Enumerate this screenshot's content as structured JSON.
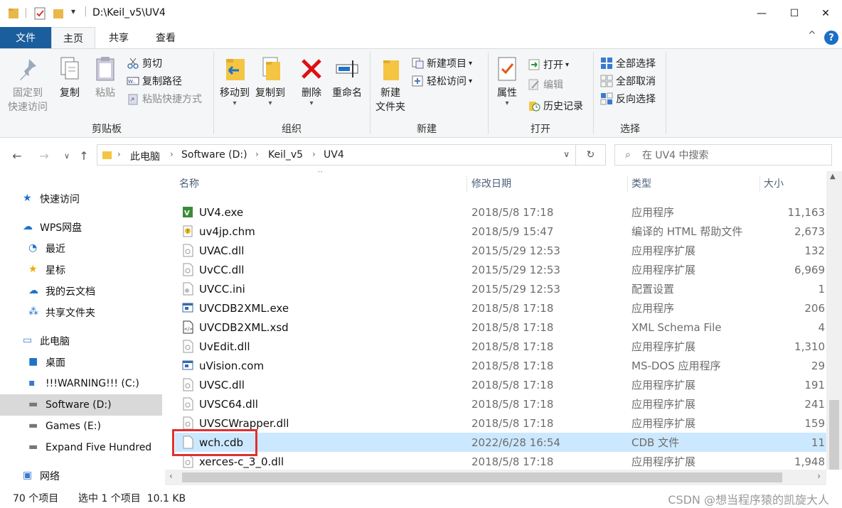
{
  "window": {
    "title": "D:\\Keil_v5\\UV4",
    "minimize": "—",
    "maximize": "☐",
    "close": "✕",
    "help": "?",
    "collapse": "^"
  },
  "tabs": [
    {
      "label": "文件"
    },
    {
      "label": "主页"
    },
    {
      "label": "共享"
    },
    {
      "label": "查看"
    }
  ],
  "ribbon": {
    "clipboard": {
      "label": "剪贴板",
      "pin": "固定到\n快速访问",
      "pin_line1": "固定到",
      "pin_line2": "快速访问",
      "copy": "复制",
      "paste": "粘贴",
      "cut": "剪切",
      "copy_path": "复制路径",
      "paste_shortcut": "粘贴快捷方式"
    },
    "organize": {
      "label": "组织",
      "move_to": "移动到",
      "copy_to": "复制到",
      "delete": "删除",
      "rename": "重命名"
    },
    "new": {
      "label": "新建",
      "new_folder_line1": "新建",
      "new_folder_line2": "文件夹",
      "new_item": "新建项目",
      "easy_access": "轻松访问"
    },
    "open": {
      "label": "打开",
      "properties": "属性",
      "open": "打开",
      "edit": "编辑",
      "history": "历史记录"
    },
    "select": {
      "label": "选择",
      "select_all": "全部选择",
      "select_none": "全部取消",
      "invert": "反向选择"
    }
  },
  "address": {
    "crumbs": [
      "此电脑",
      "Software (D:)",
      "Keil_v5",
      "UV4"
    ],
    "search_placeholder": "在 UV4 中搜索"
  },
  "navpane": [
    {
      "label": "快速访问",
      "icon": "star-icon"
    },
    {
      "label": "WPS网盘",
      "icon": "cloud-icon"
    },
    {
      "label": "最近",
      "icon": "clock-icon"
    },
    {
      "label": "星标",
      "icon": "star-icon"
    },
    {
      "label": "我的云文档",
      "icon": "cloud-icon"
    },
    {
      "label": "共享文件夹",
      "icon": "share-icon"
    },
    {
      "label": "此电脑",
      "icon": "computer-icon"
    },
    {
      "label": "桌面",
      "icon": "desktop-icon"
    },
    {
      "label": "!!!WARNING!!! (C:)",
      "icon": "drive-icon"
    },
    {
      "label": "Software (D:)",
      "icon": "drive-icon"
    },
    {
      "label": "Games (E:)",
      "icon": "drive-icon"
    },
    {
      "label": "Expand Five Hundred",
      "icon": "drive-icon"
    },
    {
      "label": "网络",
      "icon": "network-icon"
    }
  ],
  "columns": {
    "name": "名称",
    "date": "修改日期",
    "type": "类型",
    "size": "大小"
  },
  "files": [
    {
      "name": "UV4.exe",
      "date": "2018/5/8 17:18",
      "type": "应用程序",
      "size": "11,163",
      "icon": "exe-icon"
    },
    {
      "name": "uv4jp.chm",
      "date": "2018/5/9 15:47",
      "type": "编译的 HTML 帮助文件",
      "size": "2,673",
      "icon": "help-icon"
    },
    {
      "name": "UVAC.dll",
      "date": "2015/5/29 12:53",
      "type": "应用程序扩展",
      "size": "132",
      "icon": "dll-icon"
    },
    {
      "name": "UvCC.dll",
      "date": "2015/5/29 12:53",
      "type": "应用程序扩展",
      "size": "6,969",
      "icon": "dll-icon"
    },
    {
      "name": "UVCC.ini",
      "date": "2015/5/29 12:53",
      "type": "配置设置",
      "size": "1",
      "icon": "ini-icon"
    },
    {
      "name": "UVCDB2XML.exe",
      "date": "2018/5/8 17:18",
      "type": "应用程序",
      "size": "206",
      "icon": "window-icon"
    },
    {
      "name": "UVCDB2XML.xsd",
      "date": "2018/5/8 17:18",
      "type": "XML Schema File",
      "size": "4",
      "icon": "xsd-icon"
    },
    {
      "name": "UvEdit.dll",
      "date": "2018/5/8 17:18",
      "type": "应用程序扩展",
      "size": "1,310",
      "icon": "dll-icon"
    },
    {
      "name": "uVision.com",
      "date": "2018/5/8 17:18",
      "type": "MS-DOS 应用程序",
      "size": "29",
      "icon": "window-icon"
    },
    {
      "name": "UVSC.dll",
      "date": "2018/5/8 17:18",
      "type": "应用程序扩展",
      "size": "191",
      "icon": "dll-icon"
    },
    {
      "name": "UVSC64.dll",
      "date": "2018/5/8 17:18",
      "type": "应用程序扩展",
      "size": "241",
      "icon": "dll-icon"
    },
    {
      "name": "UVSCWrapper.dll",
      "date": "2018/5/8 17:18",
      "type": "应用程序扩展",
      "size": "159",
      "icon": "dll-icon"
    },
    {
      "name": "wch.cdb",
      "date": "2022/6/28 16:54",
      "type": "CDB 文件",
      "size": "11",
      "icon": "file-icon"
    },
    {
      "name": "xerces-c_3_0.dll",
      "date": "2018/5/8 17:18",
      "type": "应用程序扩展",
      "size": "1,948",
      "icon": "dll-icon"
    }
  ],
  "status": {
    "count": "70 个项目",
    "selected": "选中 1 个项目  10.1 KB"
  },
  "watermark": "CSDN @想当程序猿的凯旋大人",
  "colors": {
    "file_tab": "#1b5e9e",
    "selection": "#cce8ff",
    "highlight_box": "#e03030"
  }
}
